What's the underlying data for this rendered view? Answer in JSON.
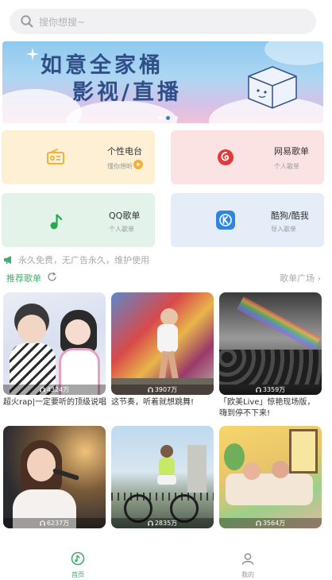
{
  "search": {
    "placeholder": "搜你想搜~"
  },
  "banner": {
    "line1": "如意全家桶",
    "line2": "影视/直播",
    "active_dot": 1,
    "dot_count": 3
  },
  "quick_cards": [
    {
      "title": "个性电台",
      "subtitle": "懂你想听",
      "icon": "radio-icon",
      "color": "#fdf0d5"
    },
    {
      "title": "网易歌单",
      "subtitle": "个人歌单",
      "icon": "netease-music-icon",
      "color": "#fbe3e4"
    },
    {
      "title": "QQ歌单",
      "subtitle": "个人歌单",
      "icon": "qq-music-icon",
      "color": "#e3f3ea"
    },
    {
      "title": "酷狗/酷我",
      "subtitle": "导入歌单",
      "icon": "kugou-icon",
      "color": "#e5eef8"
    }
  ],
  "notice": {
    "text": "永久免费，无广告永久，维护使用",
    "icon": "megaphone-icon"
  },
  "section": {
    "title": "推荐歌单",
    "plaza": "歌单广场 ›"
  },
  "playlists": [
    {
      "plays": "4324万",
      "caption": "超火rap|一定要听的顶级说唱"
    },
    {
      "plays": "3907万",
      "caption": "这节奏，听着就想跳舞!"
    },
    {
      "plays": "3359万",
      "caption": "「欧美Live」惊艳现场版，嗨到停不下来!"
    },
    {
      "plays": "6237万",
      "caption": ""
    },
    {
      "plays": "2835万",
      "caption": ""
    },
    {
      "plays": "3564万",
      "caption": ""
    }
  ],
  "tabs": [
    {
      "label": "首页",
      "icon": "music-disc-icon",
      "active": true
    },
    {
      "label": "我的",
      "icon": "user-icon",
      "active": false
    }
  ],
  "colors": {
    "accent": "#3fae6a",
    "text": "#333333",
    "muted": "#a9a9ad"
  }
}
